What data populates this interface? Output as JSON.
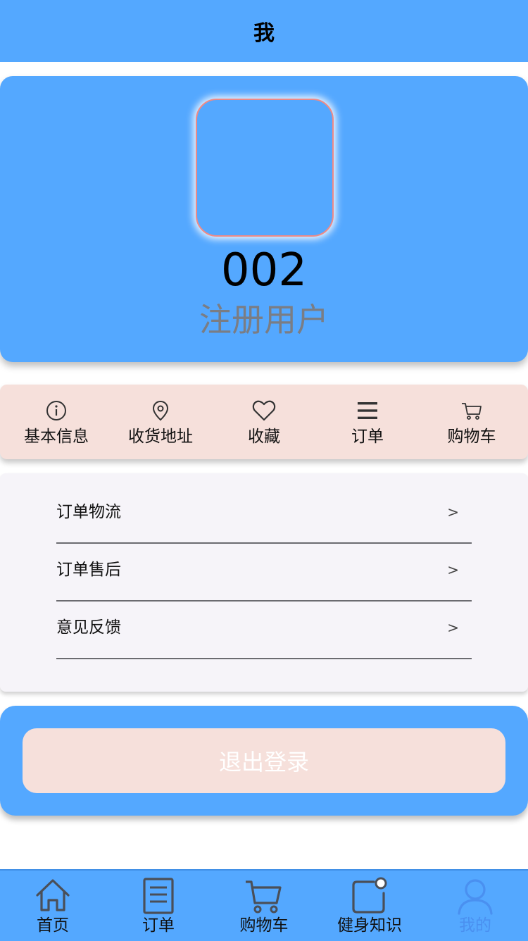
{
  "header": {
    "title": "我"
  },
  "profile": {
    "user_id": "002",
    "role": "注册用户"
  },
  "quick_actions": [
    {
      "label": "基本信息",
      "icon": "info-icon"
    },
    {
      "label": "收货地址",
      "icon": "location-pin-icon"
    },
    {
      "label": "收藏",
      "icon": "heart-icon"
    },
    {
      "label": "订单",
      "icon": "menu-lines-icon"
    },
    {
      "label": "购物车",
      "icon": "cart-icon"
    }
  ],
  "menu": [
    {
      "label": "订单物流",
      "arrow": ">"
    },
    {
      "label": "订单售后",
      "arrow": ">"
    },
    {
      "label": "意见反馈",
      "arrow": ">"
    }
  ],
  "logout": {
    "label": "退出登录"
  },
  "tabbar": {
    "active": "我的",
    "items": [
      {
        "label": "首页",
        "icon": "home-icon"
      },
      {
        "label": "订单",
        "icon": "document-icon"
      },
      {
        "label": "购物车",
        "icon": "cart-icon"
      },
      {
        "label": "健身知识",
        "icon": "notification-icon"
      },
      {
        "label": "我的",
        "icon": "user-icon"
      }
    ]
  },
  "colors": {
    "primary_blue": "#54a8ff",
    "peach": "#f6e0db",
    "active_tab": "#4a90f0"
  }
}
